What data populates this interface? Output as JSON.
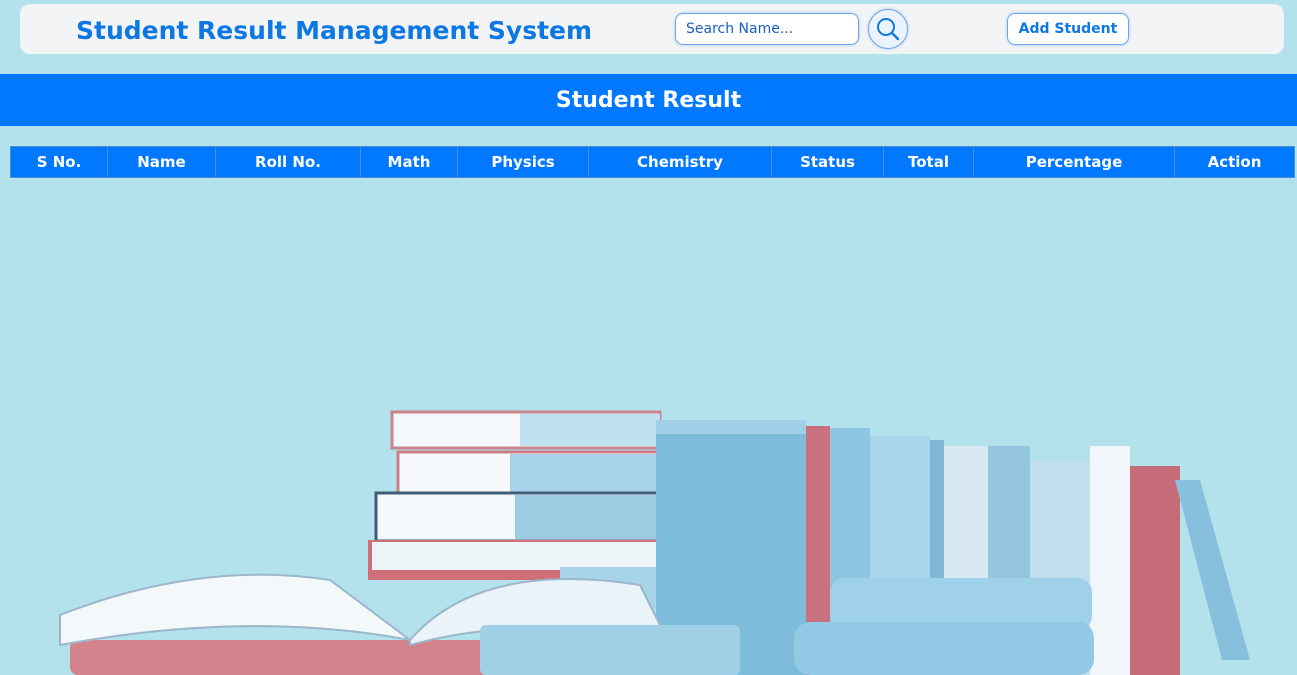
{
  "header": {
    "title": "Student Result Management System",
    "search": {
      "placeholder": "Search Name...",
      "value": ""
    },
    "search_button_icon": "search-icon",
    "add_button_label": "Add Student"
  },
  "banner": {
    "title": "Student Result"
  },
  "table": {
    "columns": [
      "S No.",
      "Name",
      "Roll No.",
      "Math",
      "Physics",
      "Chemistry",
      "Status",
      "Total",
      "Percentage",
      "Action"
    ],
    "rows": []
  },
  "colors": {
    "background": "#b3e2ec",
    "accent": "#0078ff",
    "title": "#0d78e3",
    "header_bar": "#f3f4f5"
  },
  "background_image": "books-illustration"
}
